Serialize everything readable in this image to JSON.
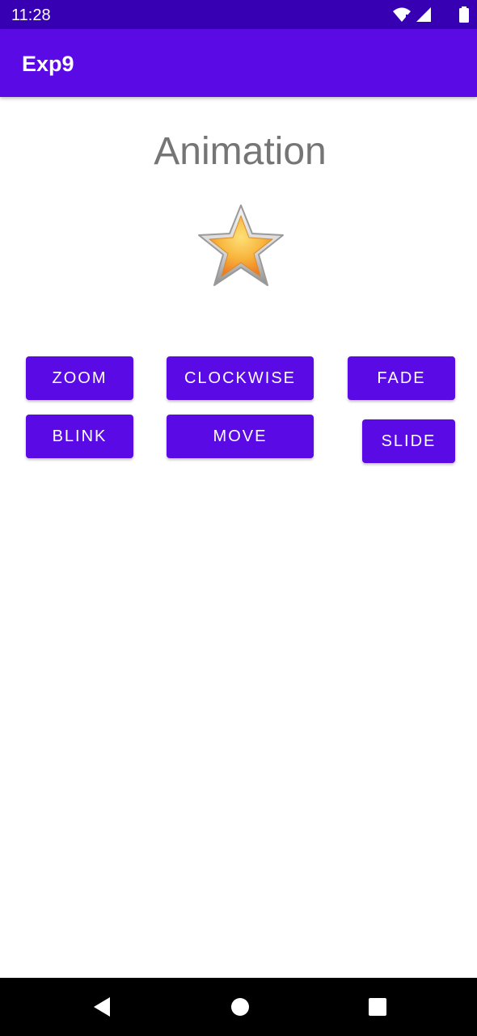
{
  "status_bar": {
    "time": "11:28",
    "icons": [
      "wifi-icon",
      "signal-icon",
      "battery-icon"
    ]
  },
  "app_bar": {
    "title": "Exp9",
    "color": "#5a0ae4"
  },
  "main": {
    "heading": "Animation",
    "image": "star-icon",
    "buttons": {
      "zoom": "ZOOM",
      "clockwise": "CLOCKWISE",
      "fade": "FADE",
      "blink": "BLINK",
      "move": "MOVE",
      "slide": "SLIDE"
    },
    "button_color": "#5a0ae4"
  },
  "nav_bar": {
    "icons": [
      "back-icon",
      "home-icon",
      "recents-icon"
    ]
  }
}
